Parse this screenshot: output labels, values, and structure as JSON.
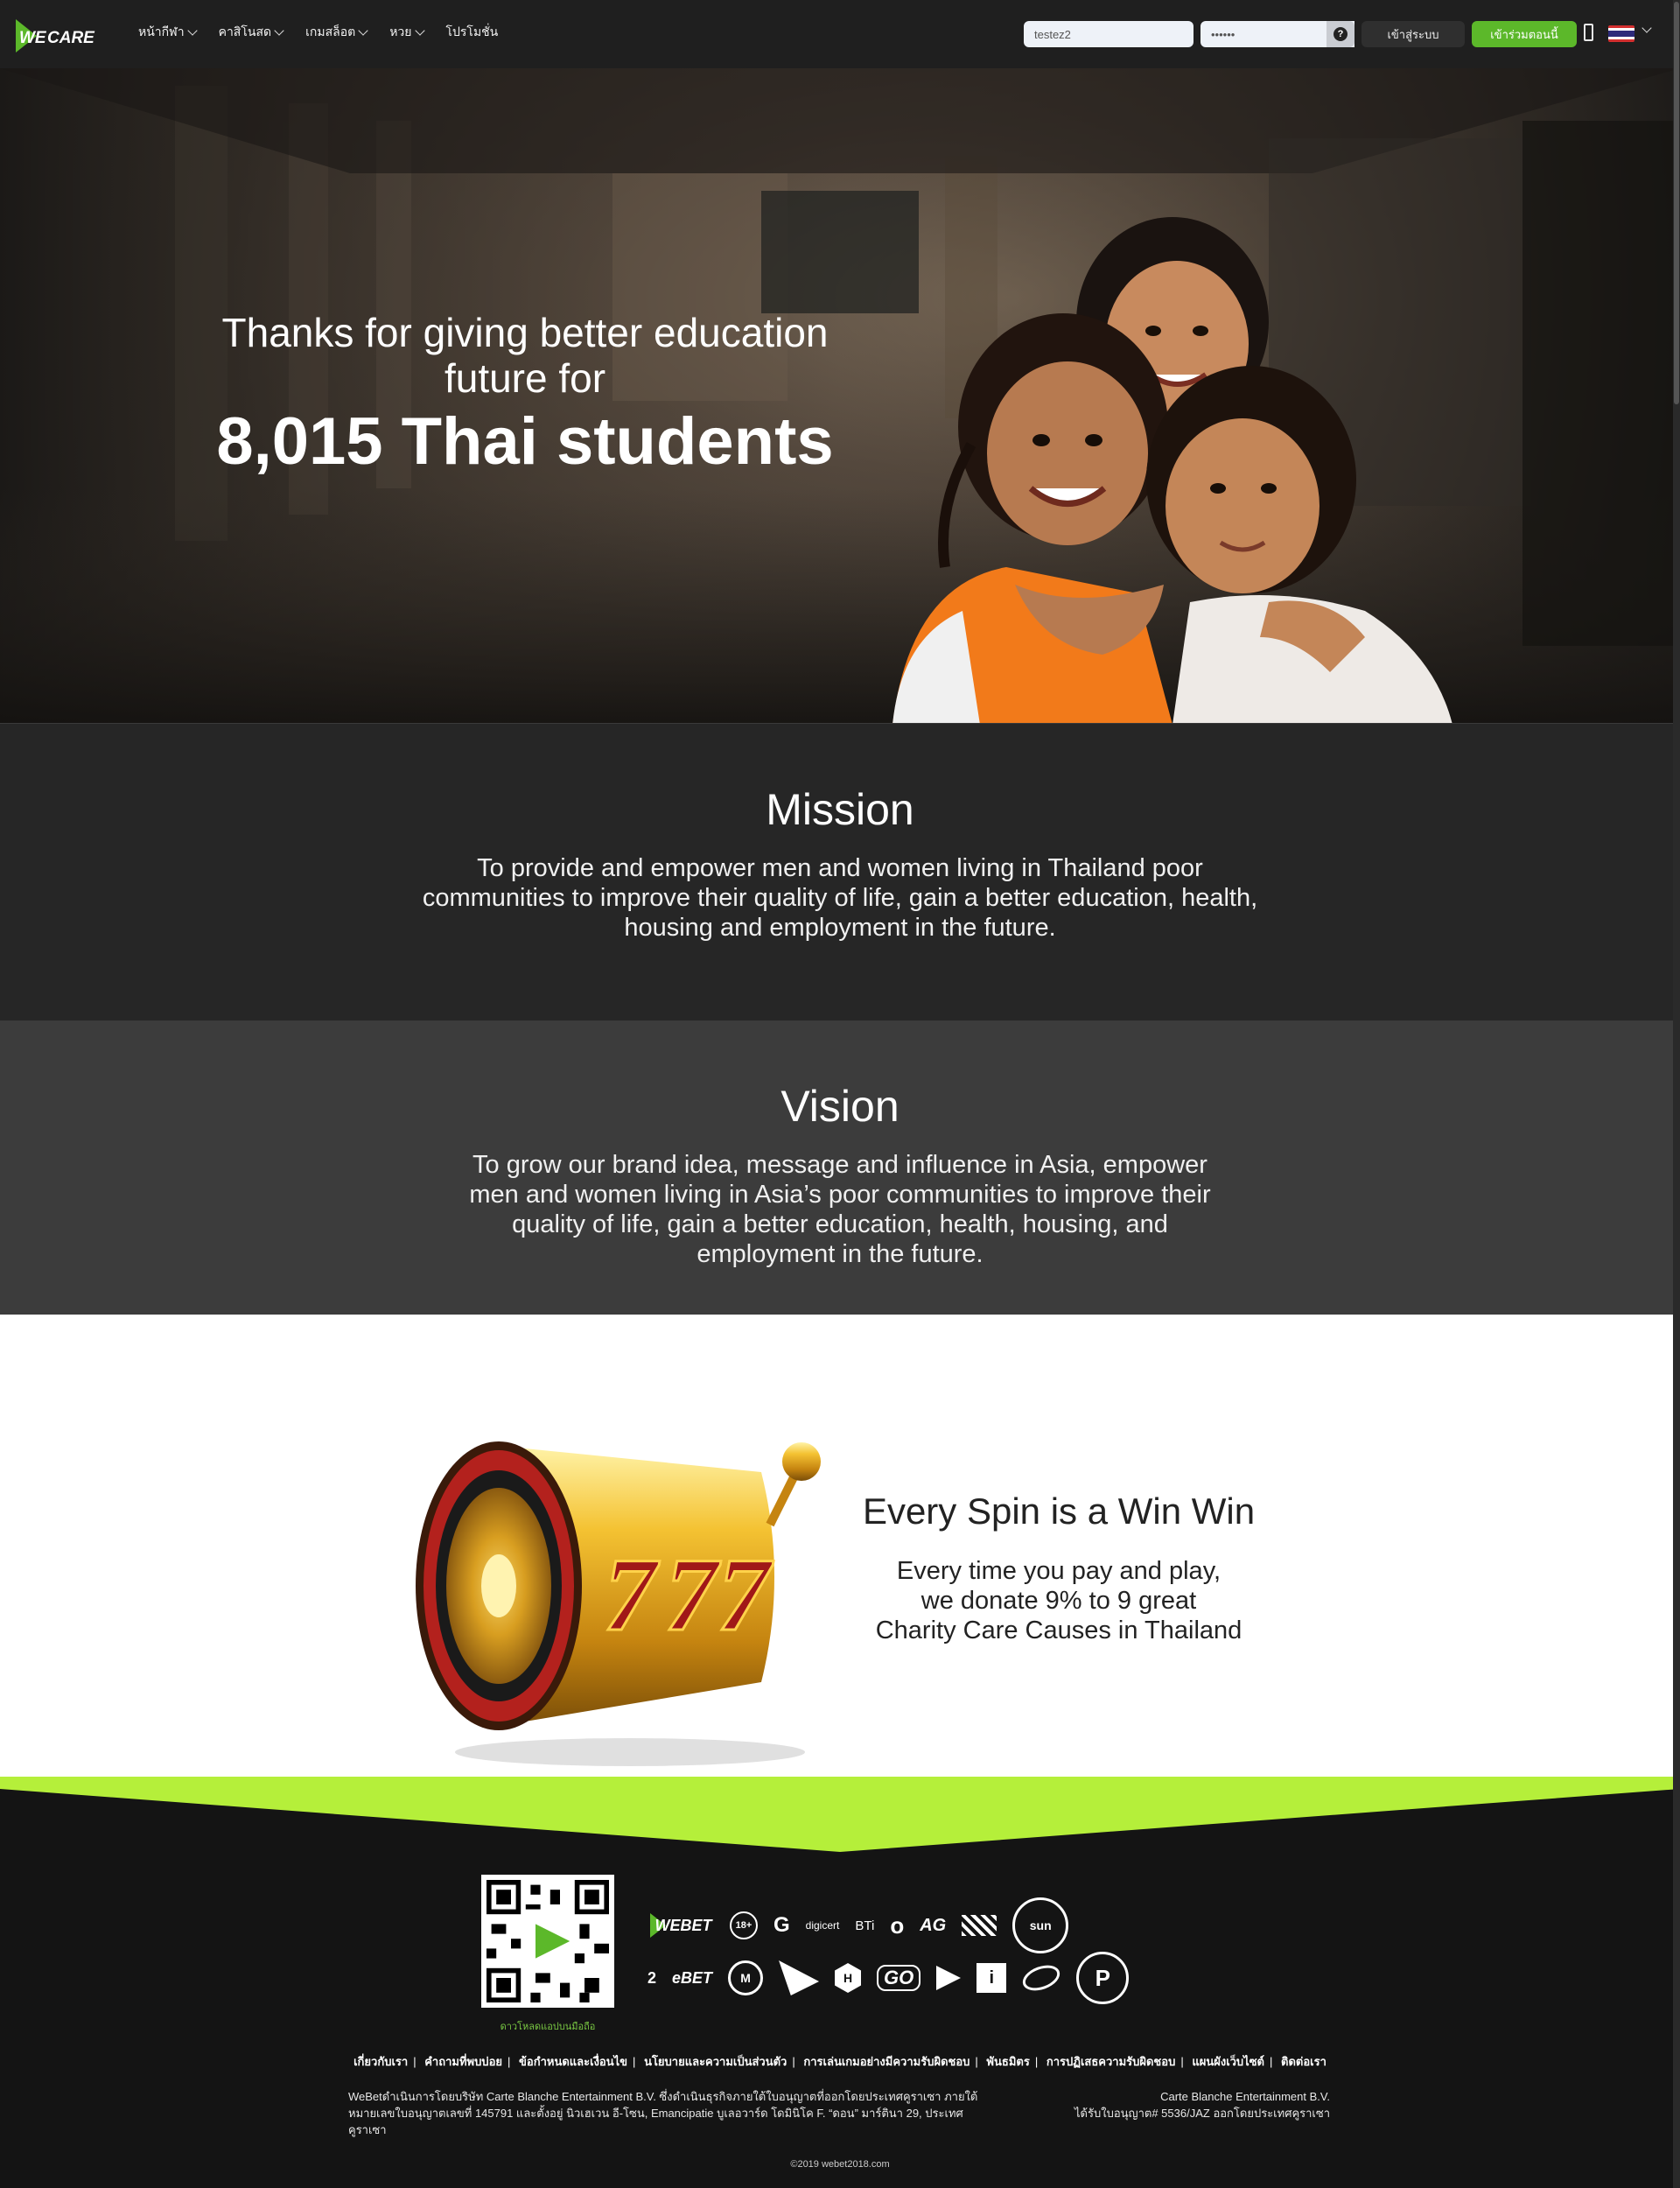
{
  "header": {
    "logo_text_we": "WE",
    "logo_text_care": "CARE",
    "nav": [
      {
        "label": "หน้ากีฬา"
      },
      {
        "label": "คาสิโนสด"
      },
      {
        "label": "เกมสล็อต"
      },
      {
        "label": "หวย"
      },
      {
        "label": "โปรโมชั่น"
      }
    ],
    "username_value": "testez2",
    "password_value": "••••••",
    "help_glyph": "?",
    "login_label": "เข้าสู่ระบบ",
    "join_label": "เข้าร่วมตอนนี้",
    "flag": "thailand-flag-icon"
  },
  "hero": {
    "line1": "Thanks for giving better education",
    "line2": "future for",
    "headline": "8,015 Thai students"
  },
  "mission": {
    "title": "Mission",
    "body": "To provide and empower men and women living in Thailand poor communities to improve their quality of life, gain a better education, health, housing and employment in the future."
  },
  "vision": {
    "title": "Vision",
    "body": "To grow our brand idea, message and influence in Asia, empower men and women living in Asia’s poor communities to improve their quality of life, gain a better education, health, housing, and employment in the future."
  },
  "spin": {
    "title": "Every Spin is a Win Win",
    "line1": "Every time you pay and play,",
    "line2": "we donate 9% to 9 great",
    "line3": "Charity Care Causes in Thailand",
    "reel_digits": [
      "7",
      "7",
      "7"
    ]
  },
  "footer": {
    "qr_caption": "ดาวโหลดแอปบนมือถือ",
    "partners_row1": [
      "WEBET",
      "18+",
      "G",
      "digicert",
      "BTi",
      "o",
      "AG",
      "flag",
      "sun"
    ],
    "partners_row2": [
      "2",
      "eBET",
      "M",
      "arrow",
      "H",
      "GO",
      "play",
      "i",
      "swirl",
      "P"
    ],
    "links": [
      "เกี่ยวกับเรา",
      "คำถามที่พบบ่อย",
      "ข้อกำหนดและเงื่อนไข",
      "นโยบายและความเป็นส่วนตัว",
      "การเล่นเกมอย่างมีความรับผิดชอบ",
      "พันธมิตร",
      "การปฏิเสธความรับผิดชอบ",
      "แผนผังเว็บไซต์",
      "ติดต่อเรา"
    ],
    "legal_left": "WeBetดำเนินการโดยบริษัท Carte Blanche Entertainment B.V. ซึ่งดำเนินธุรกิจภายใต้ใบอนุญาตที่ออกโดยประเทศคูราเซา ภายใต้หมายเลขใบอนุญาตเลขที่ 145791 และตั้งอยู่ นิวเฮเวน อี-โซน, Emancipatie บูเลอวาร์ด โดมินิโค F. “ดอน” มาร์ตินา 29, ประเทศคูราเซา",
    "legal_right_1": "Carte Blanche Entertainment B.V.",
    "legal_right_2": "ได้รับใบอนุญาต# 5536/JAZ ออกโดยประเทศคูราเซา",
    "copyright": "©2019 webet2018.com"
  },
  "colors": {
    "accent_green": "#5cb82a",
    "lime": "#b5ef3a",
    "header_bg": "#1f1f1f"
  }
}
